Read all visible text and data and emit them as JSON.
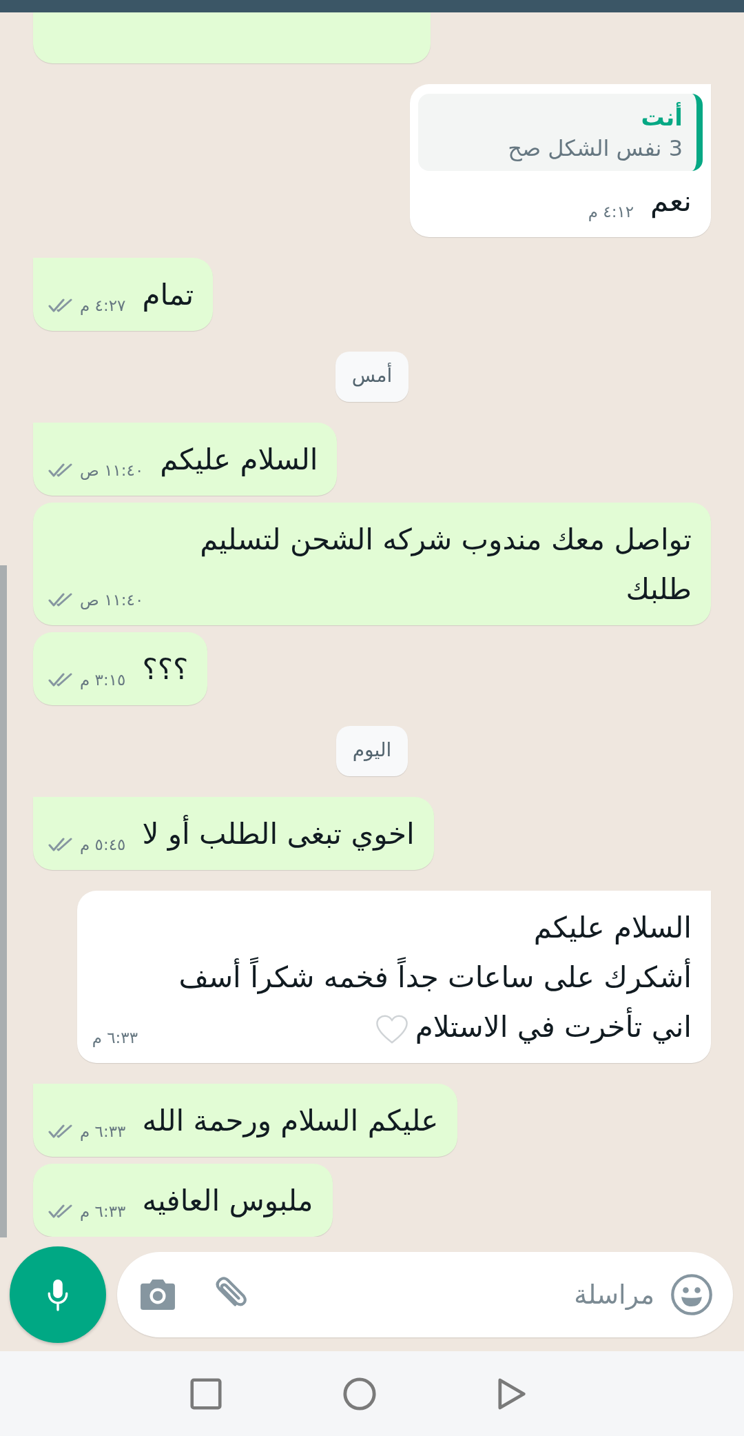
{
  "messages": [
    {
      "kind": "outgoing"
    },
    {
      "kind": "incoming",
      "tail": true,
      "reply_to": {
        "author": "أنت",
        "text": "3 نفس الشكل صح"
      },
      "text": "نعم",
      "time": "٤:١٢ م"
    },
    {
      "kind": "outgoing",
      "tail": true,
      "text": "تمام",
      "time": "٤:٢٧ م",
      "read": false
    },
    {
      "kind": "date",
      "text": "أمس"
    },
    {
      "kind": "outgoing",
      "tail": true,
      "text": "السلام عليكم",
      "time": "١١:٤٠ ص",
      "read": false
    },
    {
      "kind": "outgoing",
      "tail": false,
      "text": "تواصل معك مندوب شركه الشحن لتسليم طلبك",
      "time": "١١:٤٠ ص",
      "read": false
    },
    {
      "kind": "outgoing",
      "tail": false,
      "text": "؟؟؟",
      "time": "٣:١٥ م",
      "read": false
    },
    {
      "kind": "date",
      "text": "اليوم"
    },
    {
      "kind": "outgoing",
      "tail": true,
      "text": "اخوي تبغى الطلب أو لا",
      "time": "٥:٤٥ م",
      "read": false
    },
    {
      "kind": "incoming",
      "tail": true,
      "text": "السلام عليكم\nأشكرك على ساعات جداً فخمه شكراً أسف اني تأخرت في الاستلام",
      "heart": true,
      "time": "٦:٣٣ م"
    },
    {
      "kind": "outgoing",
      "tail": true,
      "text": "عليكم السلام ورحمة الله",
      "time": "٦:٣٣ م",
      "read": false
    },
    {
      "kind": "outgoing",
      "tail": false,
      "text": "ملبوس العافيه",
      "time": "٦:٣٣ م",
      "read": false
    }
  ],
  "composer": {
    "placeholder": "مراسلة"
  }
}
